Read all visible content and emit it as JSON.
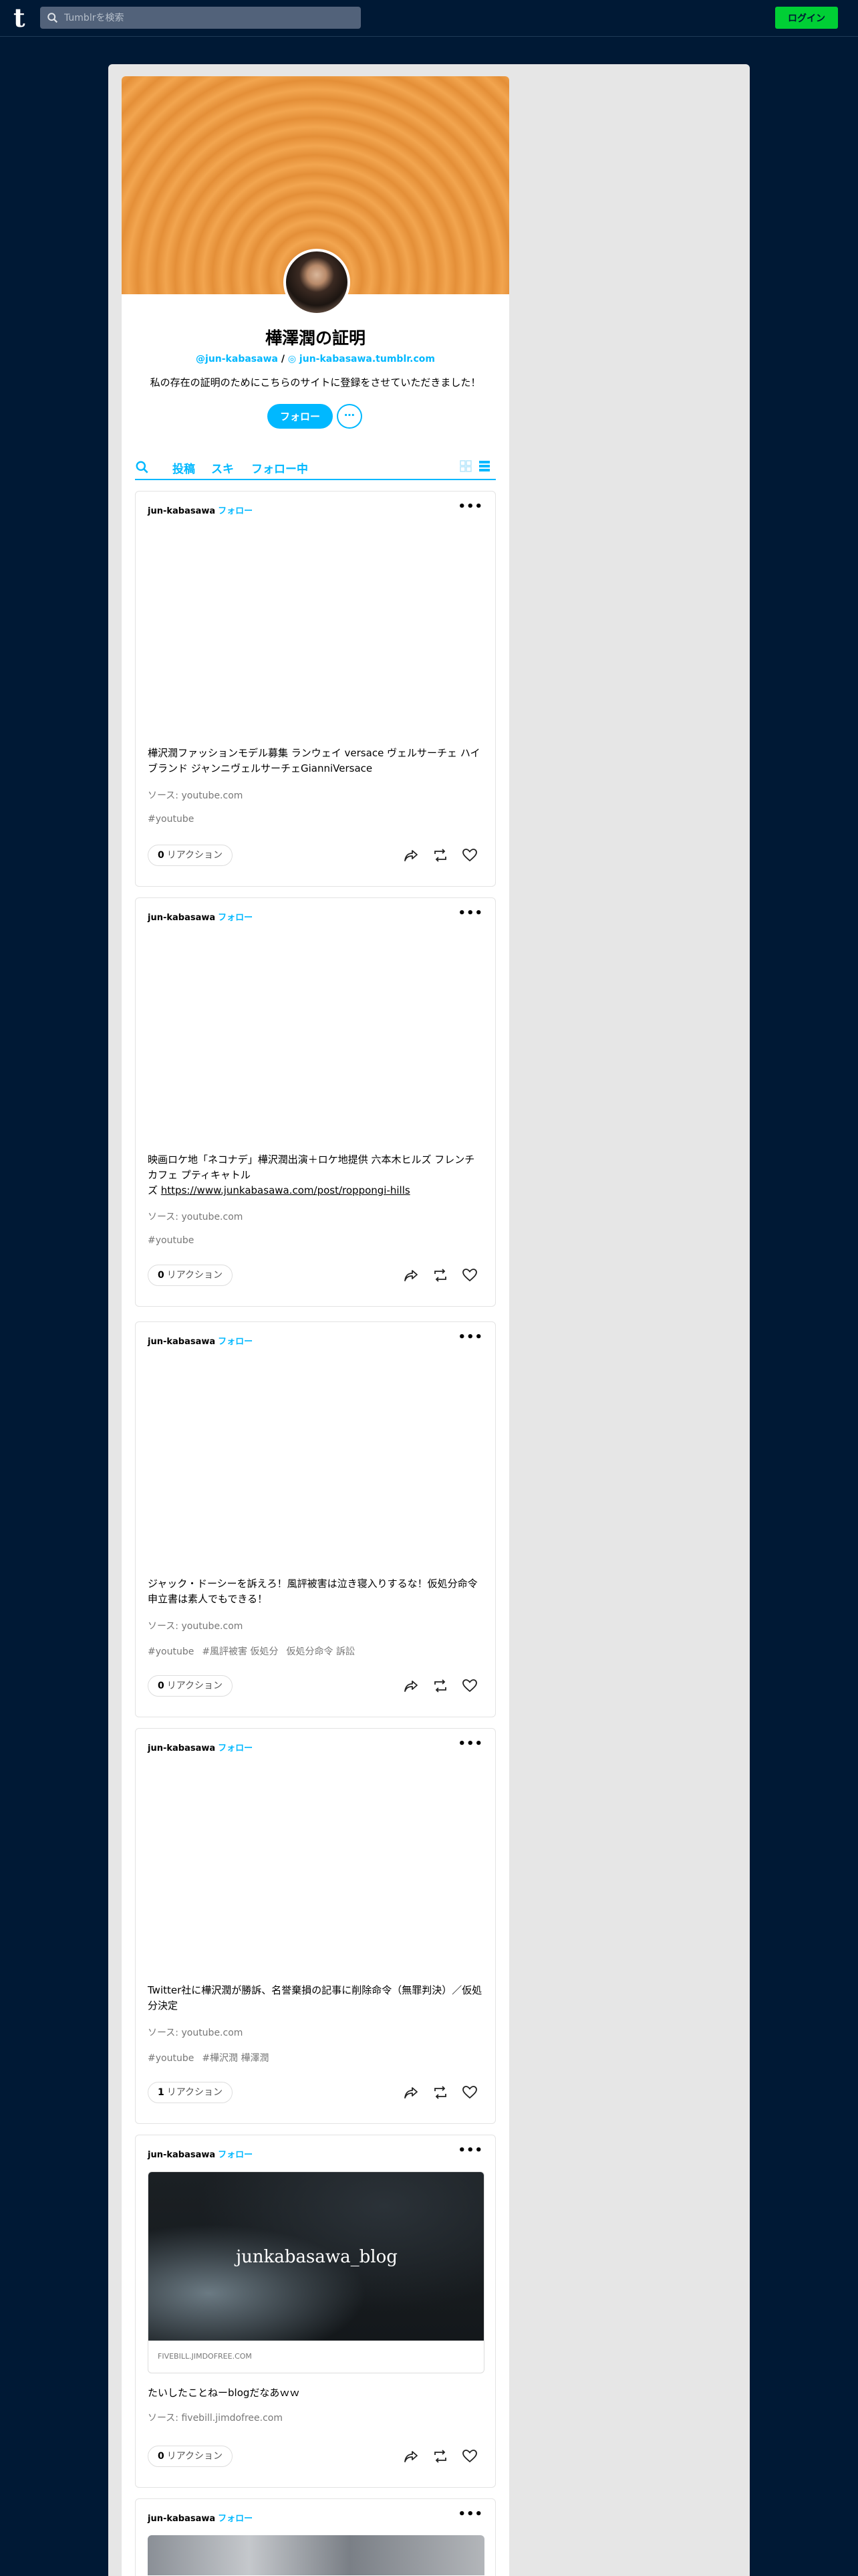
{
  "topnav": {
    "search_placeholder": "Tumblrを検索",
    "login_label": "ログイン"
  },
  "blog": {
    "title": "樺澤潤の証明",
    "handle": "@jun-kabasawa",
    "separator": "/",
    "url": "jun-kabasawa.tumblr.com",
    "description": "私の存在の証明のためにこちらのサイトに登録をさせていただきました！",
    "follow_label": "フォロー",
    "more_label": "⋯"
  },
  "tabs": {
    "posts": "投稿",
    "likes": "スキ",
    "following": "フォロー中"
  },
  "posts": [
    {
      "author": "jun-kabasawa",
      "follow": "フォロー",
      "body": "樺沢潤ファッションモデル募集 ランウェイ versace ヴェルサーチェ ハイブランド ジャンニヴェルサーチェGianniVersace",
      "source": "ソース: youtube.com",
      "tags": [
        "#youtube"
      ],
      "reactions_count": "0",
      "reactions_label": "リアクション"
    },
    {
      "author": "jun-kabasawa",
      "follow": "フォロー",
      "body": "映画ロケ地「ネコナデ」樺沢潤出演＋ロケ地提供 六本木ヒルズ フレンチカフェ プティキャトル",
      "body_prefix": "ズ ",
      "link": "https://www.junkabasawa.com/post/roppongi-hills",
      "source": "ソース: youtube.com",
      "tags": [
        "#youtube"
      ],
      "reactions_count": "0",
      "reactions_label": "リアクション"
    },
    {
      "author": "jun-kabasawa",
      "follow": "フォロー",
      "body": "ジャック・ドーシーを訴えろ！風評被害は泣き寝入りするな！仮処分命令申立書は素人でもできる！",
      "source": "ソース: youtube.com",
      "tags": [
        "#youtube",
        "#風評被害 仮処分",
        "仮処分命令 訴訟"
      ],
      "reactions_count": "0",
      "reactions_label": "リアクション"
    },
    {
      "author": "jun-kabasawa",
      "follow": "フォロー",
      "body": "Twitter社に樺沢潤が勝訴、名誉棄損の記事に削除命令（無罪判決）／仮処分決定",
      "source": "ソース: youtube.com",
      "tags": [
        "#youtube",
        "#樺沢潤 樺澤潤"
      ],
      "reactions_count": "1",
      "reactions_label": "リアクション"
    },
    {
      "author": "jun-kabasawa",
      "follow": "フォロー",
      "link_title": "junkabasawa_blog",
      "link_domain": "FIVEBILL.JIMDOFREE.COM",
      "body": "たいしたことねーblogだなあｗｗ",
      "source": "ソース: fivebill.jimdofree.com",
      "reactions_count": "0",
      "reactions_label": "リアクション"
    },
    {
      "author": "jun-kabasawa",
      "follow": "フォロー"
    }
  ],
  "icons": {
    "logo": "tumblr-logo",
    "search": "search-icon",
    "share": "share-icon",
    "reblog": "reblog-icon",
    "like": "heart-icon",
    "grid": "grid-view-icon",
    "list": "list-view-icon"
  },
  "colors": {
    "background": "#001935",
    "accent": "#00b8ff",
    "login": "#00cf35",
    "header": "#f2a54f"
  }
}
